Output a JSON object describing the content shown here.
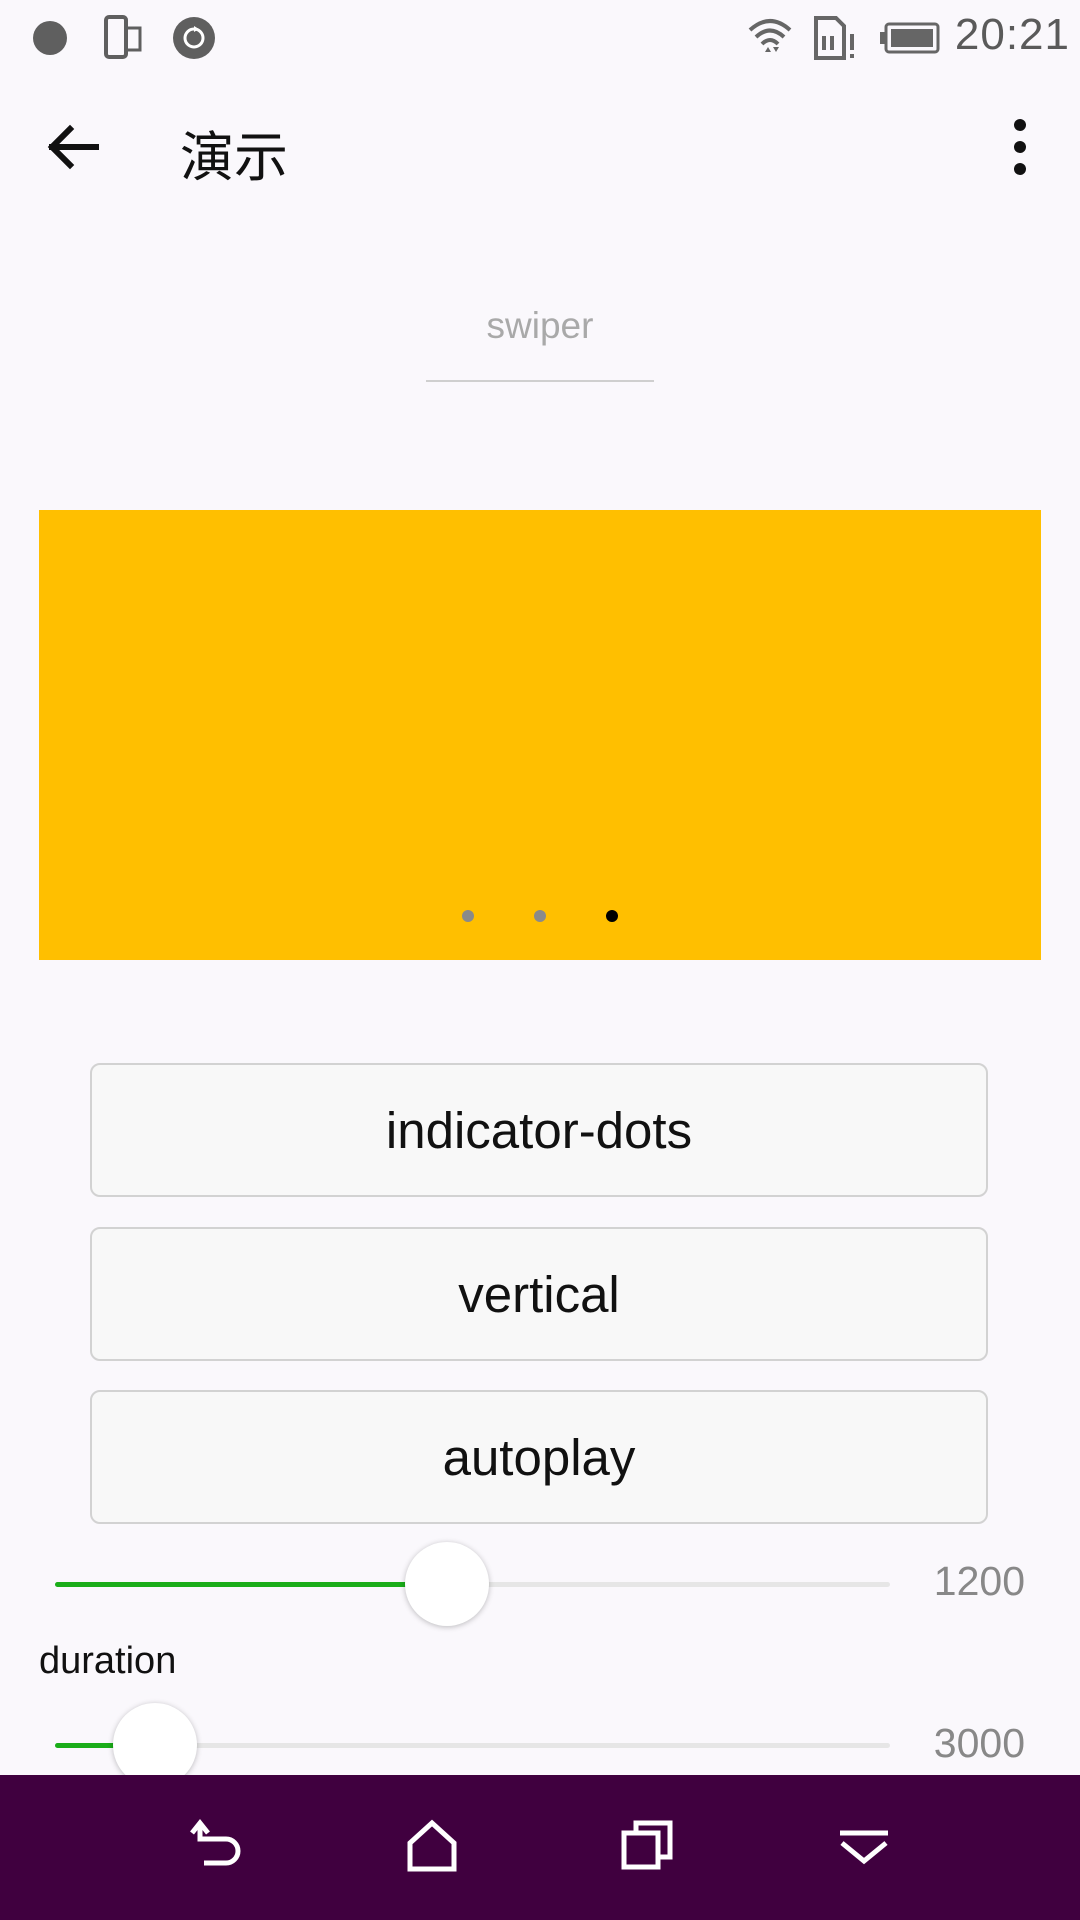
{
  "status_bar": {
    "time": "20:21",
    "icons": [
      "record-dot-icon",
      "phone-screen-icon",
      "sync-icon",
      "wifi-icon",
      "sim-alert-icon",
      "battery-icon"
    ]
  },
  "app_bar": {
    "title": "演示",
    "back_icon": "arrow-left-icon",
    "menu_icon": "more-vertical-icon"
  },
  "section": {
    "title": "swiper"
  },
  "swiper": {
    "background": "#ffbf00",
    "dot_count": 3,
    "active_dot": 3
  },
  "buttons": [
    {
      "label": "indicator-dots"
    },
    {
      "label": "vertical"
    },
    {
      "label": "autoplay"
    }
  ],
  "sliders": [
    {
      "label": "",
      "value": "1200",
      "fraction": 0.47
    },
    {
      "label": "duration",
      "value": "3000",
      "fraction": 0.12
    }
  ],
  "accent_color": "#1aad19",
  "nav_bar": {
    "background": "#40003f",
    "icons": [
      "back-icon",
      "home-icon",
      "recents-icon",
      "hide-keyboard-icon"
    ]
  }
}
